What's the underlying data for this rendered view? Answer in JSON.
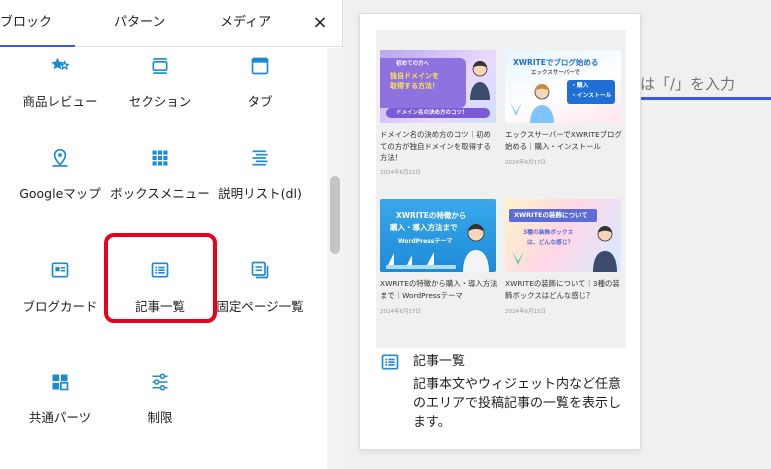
{
  "inserter": {
    "tabs": [
      "ブロック",
      "パターン",
      "メディア"
    ],
    "close_icon": "×",
    "blocks": [
      {
        "label": "商品レビュー",
        "icon": "stars-icon"
      },
      {
        "label": "セクション",
        "icon": "section-icon"
      },
      {
        "label": "タブ",
        "icon": "tab-icon"
      },
      {
        "label": "Googleマップ",
        "icon": "map-pin-icon"
      },
      {
        "label": "ボックスメニュー",
        "icon": "grid-icon"
      },
      {
        "label": "説明リスト(dl)",
        "icon": "description-list-icon"
      },
      {
        "label": "ブログカード",
        "icon": "blog-card-icon"
      },
      {
        "label": "記事一覧",
        "icon": "post-list-icon"
      },
      {
        "label": "固定ページ一覧",
        "icon": "page-list-icon"
      },
      {
        "label": "共通パーツ",
        "icon": "parts-icon"
      },
      {
        "label": "制限",
        "icon": "sliders-icon"
      }
    ]
  },
  "editor": {
    "placeholder_fragment": "は「/」を入力"
  },
  "preview": {
    "posts": [
      {
        "title": "ドメイン名の決め方のコツ｜初めての方が独自ドメインを取得する方法！",
        "date": "2024年6月22日",
        "thumb_lines": [
          "初めての方へ",
          "独自ドメインを",
          "取得する方法！",
          "ドメイン名の決め方のコツ！"
        ]
      },
      {
        "title": "エックスサーバーでXWRITEブログ始める｜購入・インストール",
        "date": "2024年6月17日",
        "thumb_lines": [
          "XWRITEでブログ始める",
          "エックスサーバーで",
          "・購入",
          "・インストール"
        ]
      },
      {
        "title": "XWRITEの特徴から購入・導入方法まで｜WordPressテーマ",
        "date": "2024年6月17日",
        "thumb_lines": [
          "XWRITEの特徴から",
          "購入・導入方法まで",
          "WordPressテーマ"
        ]
      },
      {
        "title": "XWRITEの装飾について｜3種の装飾ボックスはどんな感じ？",
        "date": "2024年6月15日",
        "thumb_lines": [
          "XWRITEの装飾について",
          "3種の装飾ボックス",
          "は、どんな感じ？"
        ]
      }
    ],
    "block_title": "記事一覧",
    "block_description": "記事本文やウィジェット内など任意のエリアで投稿記事の一覧を表示します。"
  },
  "colors": {
    "accent": "#3858e9",
    "icon_blue": "#1a8ad4",
    "highlight": "#e8001c"
  }
}
